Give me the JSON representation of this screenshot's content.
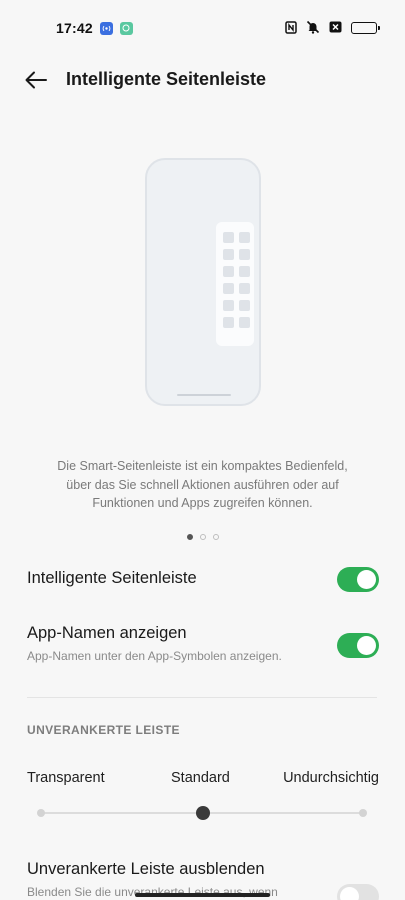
{
  "status_bar": {
    "time": "17:42",
    "app_icons": [
      {
        "name": "wireless-app-icon",
        "color": "#3b6fe0",
        "glyph": "((•))"
      },
      {
        "name": "green-app-icon",
        "color": "#5ac8a0",
        "glyph": "P"
      }
    ],
    "right_icons": [
      "nfc-icon",
      "mute-icon",
      "sim-icon",
      "battery-icon"
    ]
  },
  "header": {
    "back_icon": "arrow-left-icon",
    "title": "Intelligente Seitenleiste"
  },
  "illustration": {
    "description": "Die Smart-Seitenleiste ist ein kompaktes Bedienfeld, über das Sie schnell Aktionen ausführen oder auf Funktionen und Apps zugreifen können.",
    "pager": {
      "count": 3,
      "active": 0
    }
  },
  "settings": {
    "smart_sidebar": {
      "title": "Intelligente Seitenleiste",
      "enabled": true
    },
    "show_app_names": {
      "title": "App-Namen anzeigen",
      "subtitle": "App-Namen unter den App-Symbolen anzeigen.",
      "enabled": true
    }
  },
  "floating_bar": {
    "section_title": "UNVERANKERTE LEISTE",
    "opacity_labels": [
      "Transparent",
      "Standard",
      "Undurchsichtig"
    ],
    "opacity_selected_index": 2,
    "opacity_level": 0.5,
    "hide": {
      "title": "Unverankerte Leiste ausblenden",
      "subtitle": "Blenden Sie die unverankerte Leiste aus, wenn",
      "enabled": false
    }
  },
  "colors": {
    "accent": "#2dae55",
    "background": "#f7f7f7"
  }
}
